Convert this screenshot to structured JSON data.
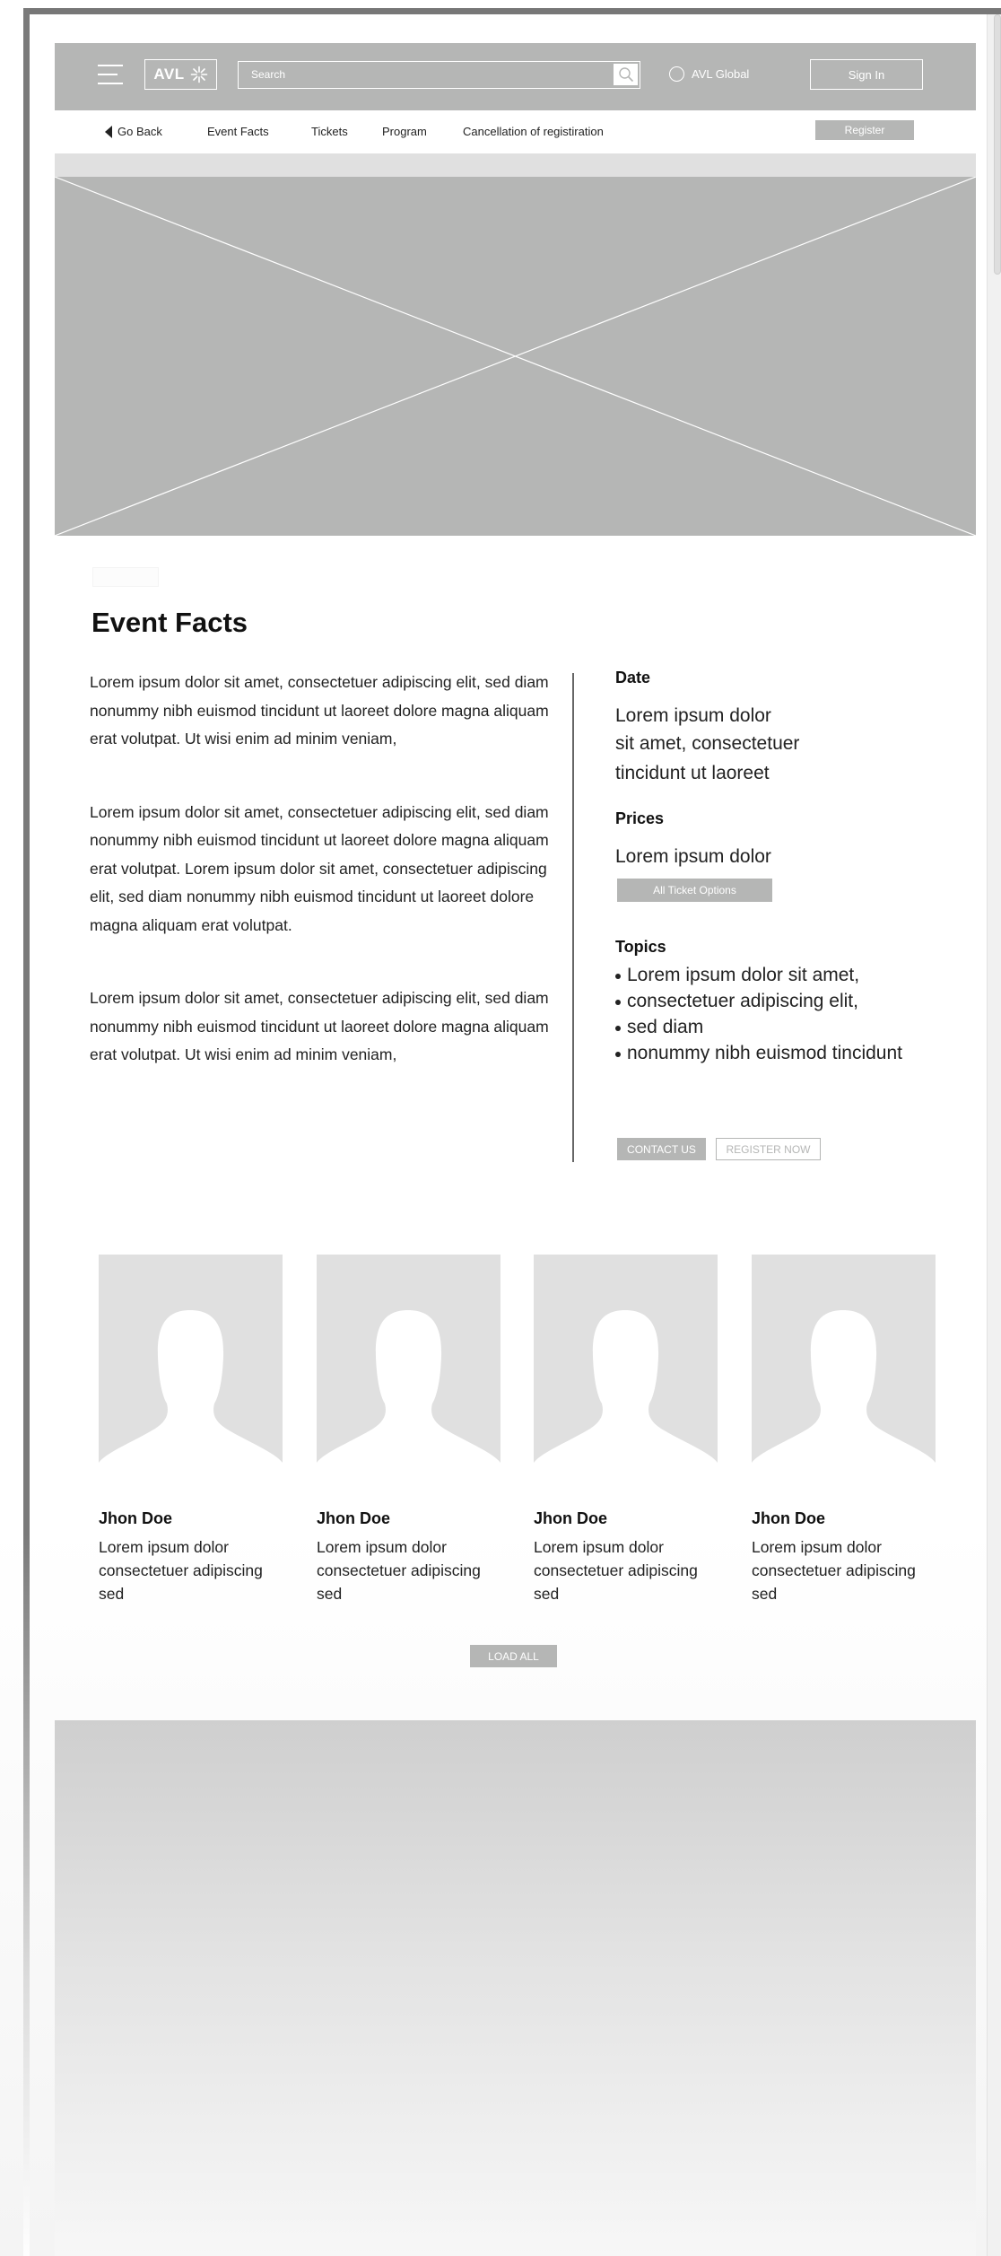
{
  "header": {
    "logo_text": "AVL",
    "search_placeholder": "Search",
    "global_label": "AVL Global",
    "signin_label": "Sign In"
  },
  "subnav": {
    "items": [
      "Go Back",
      "Event Facts",
      "Tickets",
      "Program",
      "Cancellation of registiration"
    ],
    "register_label": "Register"
  },
  "event": {
    "title": "Event Facts",
    "paragraphs": [
      "Lorem ipsum dolor sit amet, consectetuer adipiscing elit, sed diam nonummy nibh euismod tincidunt ut laoreet dolore magna aliquam erat volutpat. Ut wisi enim ad minim veniam,",
      "Lorem ipsum dolor sit amet, consectetuer adipiscing elit, sed diam nonummy nibh euismod tincidunt ut laoreet dolore magna aliquam erat volutpat. Lorem ipsum dolor sit amet, consectetuer adipiscing elit, sed diam nonummy nibh euismod tincidunt ut laoreet dolore magna aliquam erat volutpat.",
      "Lorem ipsum dolor sit amet, consectetuer adipiscing elit, sed diam nonummy nibh euismod tincidunt ut laoreet dolore magna aliquam erat volutpat. Ut wisi enim ad minim veniam,"
    ],
    "date_label": "Date",
    "date_lines": [
      "Lorem ipsum dolor",
      "sit amet, consectetuer",
      "tincidunt ut laoreet"
    ],
    "prices_label": "Prices",
    "prices_value": "Lorem ipsum dolor",
    "ticket_options_label": "All Ticket Options",
    "topics_label": "Topics",
    "topics": [
      "Lorem ipsum dolor sit amet,",
      "consectetuer adipiscing elit,",
      "sed diam",
      "nonummy nibh euismod tincidunt"
    ],
    "contact_label": "CONTACT US",
    "register_now_label": "REGISTER NOW"
  },
  "speakers": [
    {
      "name": "Jhon Doe",
      "desc": "Lorem ipsum dolor consectetuer adipiscing sed"
    },
    {
      "name": "Jhon Doe",
      "desc": "Lorem ipsum dolor consectetuer adipiscing sed"
    },
    {
      "name": "Jhon Doe",
      "desc": "Lorem ipsum dolor consectetuer adipiscing sed"
    },
    {
      "name": "Jhon Doe",
      "desc": "Lorem ipsum dolor consectetuer adipiscing sed"
    }
  ],
  "load_all_label": "LOAD ALL",
  "colors": {
    "placeholder_gray": "#b5b6b5",
    "light_gray": "#e0e0e0",
    "frame_gray": "#777777"
  },
  "icons": {
    "menu": "hamburger-menu-icon",
    "logo_mark": "snowflake-icon",
    "search": "magnifier-icon",
    "globe": "globe-icon",
    "back": "triangle-left-icon",
    "avatar": "person-silhouette-icon"
  }
}
